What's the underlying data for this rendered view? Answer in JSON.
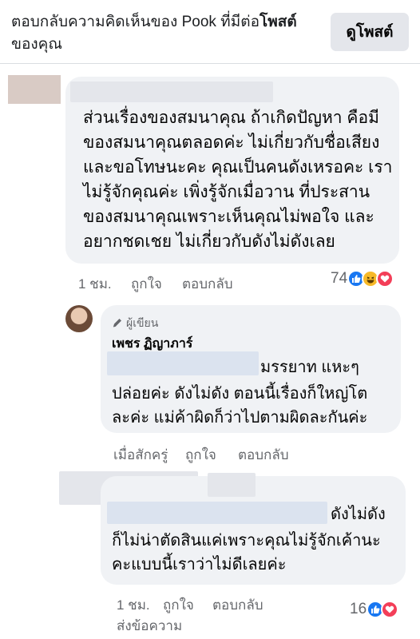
{
  "header": {
    "text_prefix": "ตอบกลับความคิดเห็นของ Pook ที่มีต่อ",
    "text_bold": "โพสต์",
    "text_suffix": "ของคุณ",
    "view_post_button": "ดูโพสต์"
  },
  "comment1": {
    "lines": [
      "ส่วนเรื่องของสมนาคุณ ถ้าเกิดปัญหา คือมี",
      "ของสมนาคุณตลอดค่ะ ไม่เกี่ยวกับชื่อเสียง",
      "และขอโทษนะคะ คุณเป็นคนดังเหรอคะ เรา",
      "ไม่รู้จักคุณค่ะ เพิ่งรู้จักเมื่อวาน  ที่ประสาน",
      "ของสมนาคุณเพราะเห็นคุณไม่พอใจ และ",
      "อยากชดเชย ไม่เกี่ยวกับดังไม่ดังเลย"
    ],
    "time": "1 ชม.",
    "like": "ถูกใจ",
    "reply": "ตอบกลับ",
    "reaction_count": "74",
    "reaction_icons": [
      "like-icon",
      "haha-icon",
      "love-icon"
    ]
  },
  "reply1": {
    "author_tag": "ผู้เขียน",
    "author_name": "เพชร ฏิญาภาร์",
    "line1_suffix": "มรรยาท แหะๆ",
    "lines": [
      "ปล่อยค่ะ ดังไม่ดัง ตอนนี้เรื่องก็ใหญ่โต",
      "ละค่ะ แม่ค้าผิดก็ว่าไปตามผิดละกันค่ะ"
    ],
    "time": "เมื่อสักครู่",
    "like": "ถูกใจ",
    "reply": "ตอบกลับ"
  },
  "reply2": {
    "line1_suffix": "ดังไม่ดัง",
    "lines": [
      "ก็ไม่น่าตัดสินแค่เพราะคุณไม่รู้จักเค้านะ",
      "คะแบบนี้เราว่าไม่ดีเลยค่ะ"
    ],
    "time": "1 ชม.",
    "like": "ถูกใจ",
    "reply": "ตอบกลับ",
    "message": "ส่งข้อความ",
    "reaction_count": "16",
    "reaction_icons": [
      "like-icon",
      "love-icon"
    ]
  },
  "colors": {
    "like_blue": "#1877f2",
    "love_red": "#f33e58",
    "haha_yellow": "#f7b928",
    "bubble_bg": "#f0f2f5",
    "secondary_text": "#65676b"
  }
}
